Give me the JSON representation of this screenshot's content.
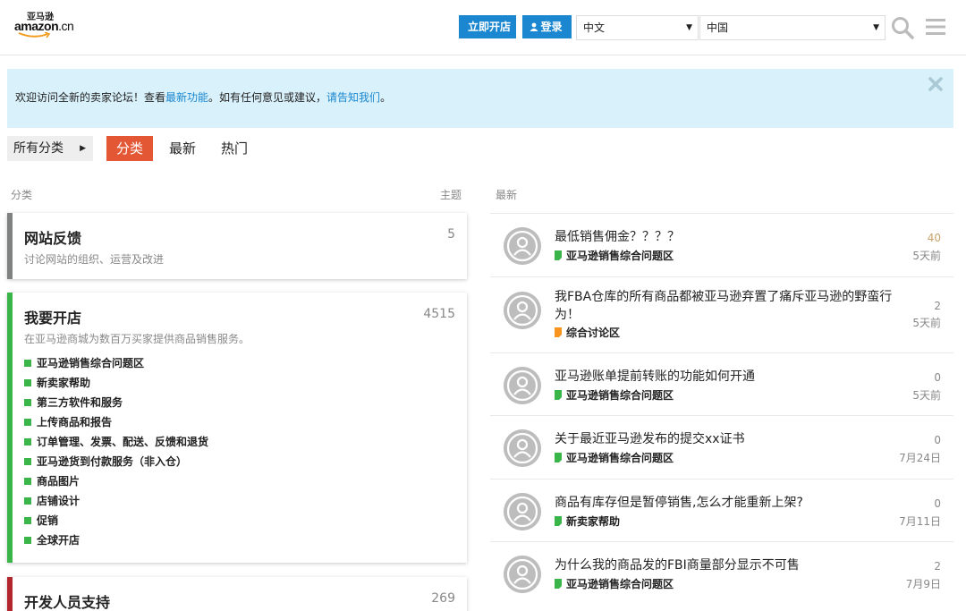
{
  "header": {
    "logo_cn": "亚马逊",
    "logo_word": "amazon",
    "logo_suffix": ".cn",
    "open_store_label": "立即开店",
    "login_label": "登录",
    "language_value": "中文",
    "region_value": "中国",
    "icons": [
      "search-icon",
      "menu-icon",
      "user-icon",
      "close-icon"
    ]
  },
  "banner": {
    "text_before": "欢迎访问全新的卖家论坛！查看",
    "link1": "最新功能",
    "text_middle": "。如有任何意见或建议，",
    "link2": "请告知我们",
    "text_after": "。"
  },
  "nav": {
    "all_categories": "所有分类",
    "tabs": [
      "分类",
      "最新",
      "热门"
    ],
    "active_tab": "分类"
  },
  "columns": {
    "categories_header": "分类",
    "topics_header": "主题",
    "latest_header": "最新"
  },
  "categories": [
    {
      "title": "网站反馈",
      "count": "5",
      "description": "讨论网站的组织、运营及改进",
      "color": "#808281",
      "subcategories": []
    },
    {
      "title": "我要开店",
      "count": "4515",
      "description": "在亚马逊商城为数百万买家提供商品销售服务。",
      "color": "#3ab54a",
      "subcategories": [
        "亚马逊销售综合问题区",
        "新卖家帮助",
        "第三方软件和服务",
        "上传商品和报告",
        "订单管理、发票、配送、反馈和退货",
        "亚马逊货到付款服务（非入仓）",
        "商品图片",
        "店铺设计",
        "促销",
        "全球开店"
      ]
    },
    {
      "title": "开发人员支持",
      "count": "269",
      "description": "",
      "color": "#b3262d",
      "subcategories": []
    }
  ],
  "latest_topics": [
    {
      "title": "最低销售佣金？？？？",
      "category": "亚马逊销售综合问题区",
      "category_color": "#3ab54a",
      "replies": "40",
      "age": "5天前"
    },
    {
      "title": "我FBA仓库的所有商品都被亚马逊弃置了痛斥亚马逊的野蛮行为！",
      "category": "综合讨论区",
      "category_color": "#f7941d",
      "replies": "2",
      "age": "5天前"
    },
    {
      "title": "亚马逊账单提前转账的功能如何开通",
      "category": "亚马逊销售综合问题区",
      "category_color": "#3ab54a",
      "replies": "0",
      "age": "5天前"
    },
    {
      "title": "关于最近亚马逊发布的提交xx证书",
      "category": "亚马逊销售综合问题区",
      "category_color": "#3ab54a",
      "replies": "0",
      "age": "7月24日"
    },
    {
      "title": "商品有库存但是暂停销售,怎么才能重新上架?",
      "category": "新卖家帮助",
      "category_color": "#3ab54a",
      "replies": "0",
      "age": "7月11日"
    },
    {
      "title": "为什么我的商品发的FBI商量部分显示不可售",
      "category": "亚马逊销售综合问题区",
      "category_color": "#3ab54a",
      "replies": "2",
      "age": "7月9日"
    }
  ]
}
